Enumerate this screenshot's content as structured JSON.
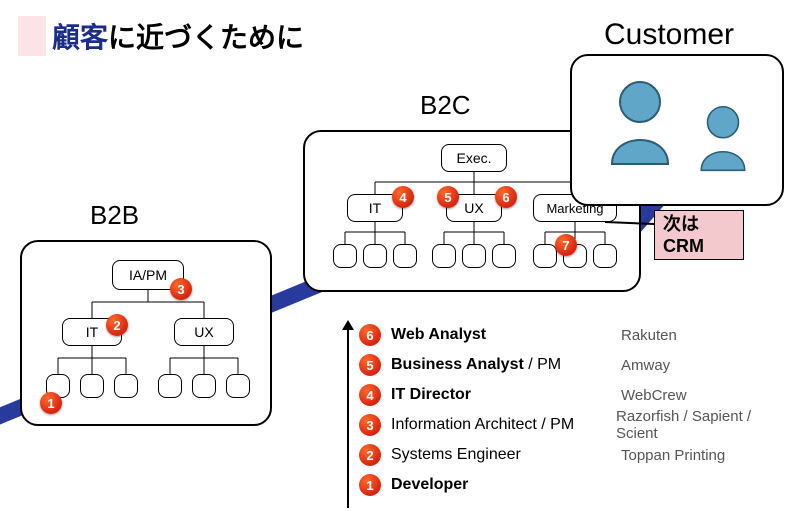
{
  "title": {
    "highlight": "顧客",
    "rest": "に近づくために"
  },
  "b2b": {
    "label": "B2B",
    "root": "IA/PM",
    "left_group": "IT",
    "right_group": "UX"
  },
  "b2c": {
    "label": "B2C",
    "root": "Exec.",
    "group1": "IT",
    "group2": "UX",
    "group3": "Marketing"
  },
  "customer": {
    "label": "Customer"
  },
  "crm": {
    "line1": "次は",
    "line2": "CRM"
  },
  "badges": {
    "b1": "1",
    "b2": "2",
    "b3": "3",
    "b4": "4",
    "b5": "5",
    "b6": "6",
    "b7": "7"
  },
  "legend": [
    {
      "num": "6",
      "role_bold": "Web Analyst",
      "role_rest": "",
      "company": "Rakuten"
    },
    {
      "num": "5",
      "role_bold": "Business Analyst",
      "role_rest": " / PM",
      "company": "Amway"
    },
    {
      "num": "4",
      "role_bold": "IT Director",
      "role_rest": "",
      "company": "WebCrew"
    },
    {
      "num": "3",
      "role_bold": "",
      "role_rest": "Information Architect / PM",
      "company": "Razorfish / Sapient / Scient"
    },
    {
      "num": "2",
      "role_bold": "",
      "role_rest": "Systems Engineer",
      "company": "Toppan Printing"
    },
    {
      "num": "1",
      "role_bold": "Developer",
      "role_rest": "",
      "company": ""
    }
  ]
}
